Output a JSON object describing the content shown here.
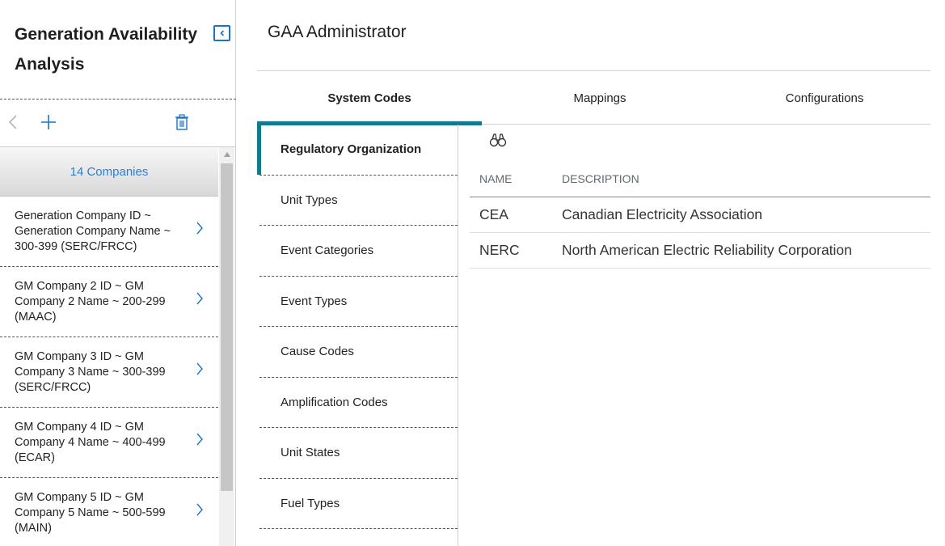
{
  "app": {
    "title": "Generation Availability Analysis"
  },
  "left": {
    "company_count_label": "14 Companies",
    "companies": [
      {
        "label": "Generation Company ID ~ Generation Company Name ~ 300-399 (SERC/FRCC)"
      },
      {
        "label": "GM Company 2 ID ~ GM Company 2 Name ~ 200-299 (MAAC)"
      },
      {
        "label": "GM Company 3 ID ~ GM Company 3 Name ~ 300-399 (SERC/FRCC)"
      },
      {
        "label": "GM Company 4 ID ~ GM Company 4 Name ~ 400-499 (ECAR)"
      },
      {
        "label": "GM Company 5 ID ~ GM Company 5 Name ~ 500-599 (MAIN)"
      }
    ],
    "icons": [
      "back-icon",
      "add-icon",
      "delete-icon",
      "collapse-icon",
      "chevron-right-icon"
    ]
  },
  "main": {
    "title": "GAA Administrator",
    "tabs": [
      {
        "label": "System Codes",
        "active": true
      },
      {
        "label": "Mappings",
        "active": false
      },
      {
        "label": "Configurations",
        "active": false
      }
    ],
    "subnav": [
      {
        "label": "Regulatory Organization",
        "active": true
      },
      {
        "label": "Unit Types",
        "active": false
      },
      {
        "label": "Event Categories",
        "active": false
      },
      {
        "label": "Event Types",
        "active": false
      },
      {
        "label": "Cause Codes",
        "active": false
      },
      {
        "label": "Amplification Codes",
        "active": false
      },
      {
        "label": "Unit States",
        "active": false
      },
      {
        "label": "Fuel Types",
        "active": false
      }
    ],
    "grid": {
      "columns": [
        "NAME",
        "DESCRIPTION"
      ],
      "rows": [
        {
          "name": "CEA",
          "description": "Canadian Electricity Association"
        },
        {
          "name": "NERC",
          "description": "North American Electric Reliability Corporation"
        }
      ]
    }
  },
  "colors": {
    "accent": "#0f7b8c",
    "link": "#2d7fd6",
    "icon_blue": "#1a73c8"
  }
}
